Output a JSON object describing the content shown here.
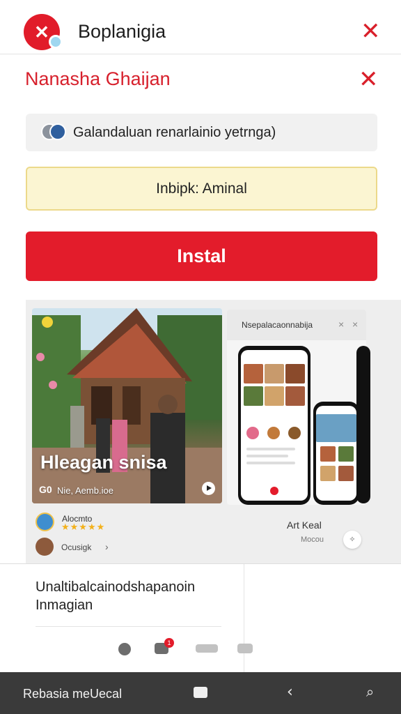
{
  "app": {
    "title": "Boplanigia",
    "logo_icon": "close-icon",
    "accent": "#e11c2a"
  },
  "dialog": {
    "title": "Nanasha Ghaijan",
    "account_text": "Galandaluan renarlainio yetrnga)",
    "notice_text": "Inbipk: Aminal",
    "install_label": "Instal"
  },
  "gallery": {
    "hero_caption": "Hleagan snisa",
    "hero_count": "G0",
    "hero_sub": "Nie, Aemb.ioe",
    "screenshot_title": "Nsepalacaonnabija",
    "screenshot_close_1": "×",
    "screenshot_close_2": "×"
  },
  "developer": {
    "name": "Alocmto",
    "stars": "★★★★★",
    "reviewer": "Ocusigk",
    "reviewer_chevron": "›"
  },
  "side": {
    "label": "Art Keal",
    "sub": "Mocou",
    "button_glyph": "✧"
  },
  "info": {
    "text": "Unaltibalcainodshapanoin Inmagian",
    "notification_count": "1"
  },
  "navbar": {
    "label": "Rebasia meUecal",
    "back_glyph": "‹",
    "mic_glyph": "⌕"
  }
}
